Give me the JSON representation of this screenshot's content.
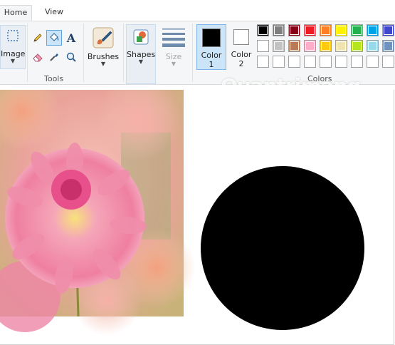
{
  "tabs": [
    {
      "label": "Home",
      "active": true
    },
    {
      "label": "View",
      "active": false
    }
  ],
  "ribbon": {
    "image_label": "Image",
    "tools_group_label": "Tools",
    "brushes_label": "Brushes",
    "shapes_label": "Shapes",
    "size_label": "Size",
    "color1_label_line1": "Color",
    "color1_label_line2": "1",
    "color2_label_line1": "Color",
    "color2_label_line2": "2",
    "colors_group_label": "Colors",
    "color1_value": "#000000",
    "color2_value": "#ffffff"
  },
  "palette": {
    "row1": [
      "#000000",
      "#7f7f7f",
      "#880015",
      "#ed1c24",
      "#ff7f27",
      "#fff200",
      "#22b14c",
      "#00a2e8",
      "#3f48cc"
    ],
    "row2": [
      "#ffffff",
      "#c3c3c3",
      "#b97a57",
      "#ffaec9",
      "#ffc90e",
      "#efe4b0",
      "#b5e61d",
      "#99d9ea",
      "#7092be"
    ],
    "row3": [
      "#ffffff",
      "#ffffff",
      "#ffffff",
      "#ffffff",
      "#ffffff",
      "#ffffff",
      "#ffffff",
      "#ffffff",
      "#ffffff"
    ]
  },
  "icons": {
    "select": "select-rectangle-icon",
    "pencil": "pencil-icon",
    "fill": "fill-bucket-icon",
    "text": "text-icon",
    "eraser": "eraser-icon",
    "picker": "color-picker-icon",
    "magnifier": "magnifier-icon",
    "brush": "brush-icon",
    "shapes": "shapes-icon",
    "size": "size-icon"
  },
  "watermark": "Quantrimang",
  "canvas": {
    "circle_color": "#000000"
  }
}
